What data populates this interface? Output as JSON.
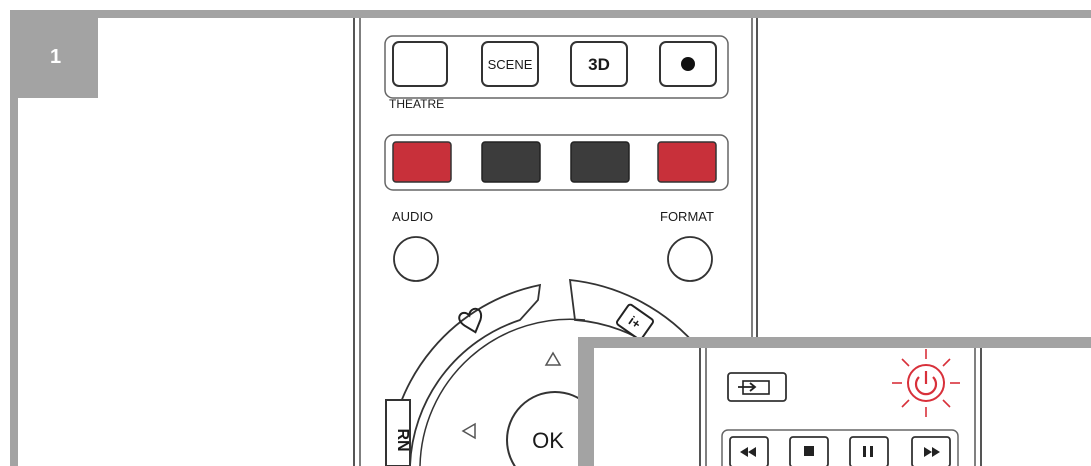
{
  "step": {
    "number": "1"
  },
  "remote": {
    "top_buttons": [
      {
        "name": "theatre",
        "label": "",
        "caption": "THEATRE"
      },
      {
        "name": "scene",
        "label": "SCENE"
      },
      {
        "name": "3d",
        "label": "3D"
      },
      {
        "name": "record",
        "label": "●"
      }
    ],
    "color_buttons": [
      {
        "name": "red",
        "color": "#c8303a"
      },
      {
        "name": "dark-1",
        "color": "#3c3c3c"
      },
      {
        "name": "dark-2",
        "color": "#3c3c3c"
      },
      {
        "name": "red-2",
        "color": "#c8303a"
      }
    ],
    "audio_label": "AUDIO",
    "format_label": "FORMAT",
    "ok_label": "OK",
    "return_label": "RN",
    "heart_icon": "heart-icon",
    "info_label": "i+"
  },
  "inset": {
    "power_color": "#d8303a"
  },
  "colors": {
    "frame": "#a3a3a3",
    "red": "#c8303a",
    "dark": "#3c3c3c"
  }
}
